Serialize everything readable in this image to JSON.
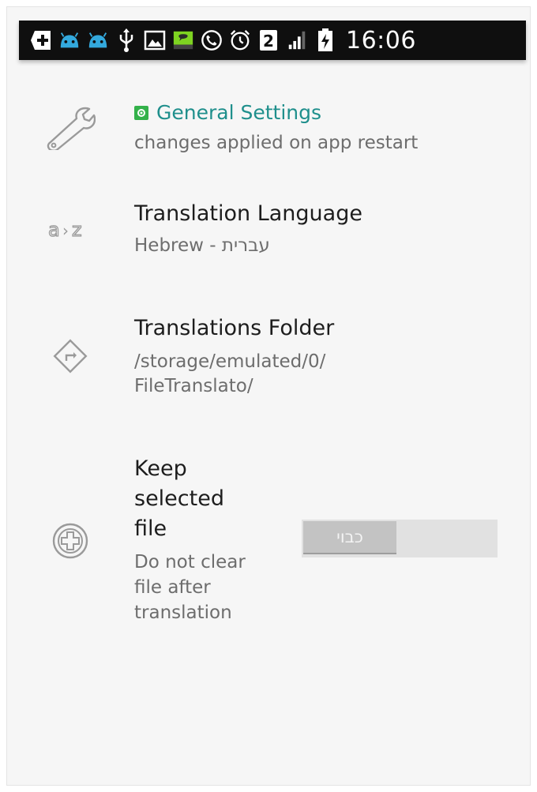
{
  "status_bar": {
    "time": "16:06",
    "notification_badge": "2",
    "icons": [
      "add-box-icon",
      "android-icon",
      "android-icon",
      "usb-icon",
      "image-icon",
      "chat-app-icon",
      "phone-call-icon",
      "alarm-clock-icon",
      "sim-2-icon",
      "signal-icon",
      "battery-charging-icon"
    ]
  },
  "settings": {
    "general": {
      "title": "General Settings",
      "summary": "changes applied on app restart"
    },
    "language": {
      "title": "Translation Language",
      "summary": "Hebrew - עברית"
    },
    "folder": {
      "title": "Translations Folder",
      "summary_line1": "/storage/emulated/0/",
      "summary_line2": "FileTranslato/"
    },
    "keep_file": {
      "title_line1": "Keep",
      "title_line2": "selected",
      "title_line3": "file",
      "summary_line1": "Do not clear",
      "summary_line2": "file after",
      "summary_line3": "translation",
      "toggle_label": "כבוי",
      "toggle_state": "off"
    }
  },
  "colors": {
    "category_title": "#1f8f8c",
    "status_bar_bg": "#0f0f0f",
    "android_icon": "#33a9dd",
    "badge_green": "#33b14a"
  }
}
